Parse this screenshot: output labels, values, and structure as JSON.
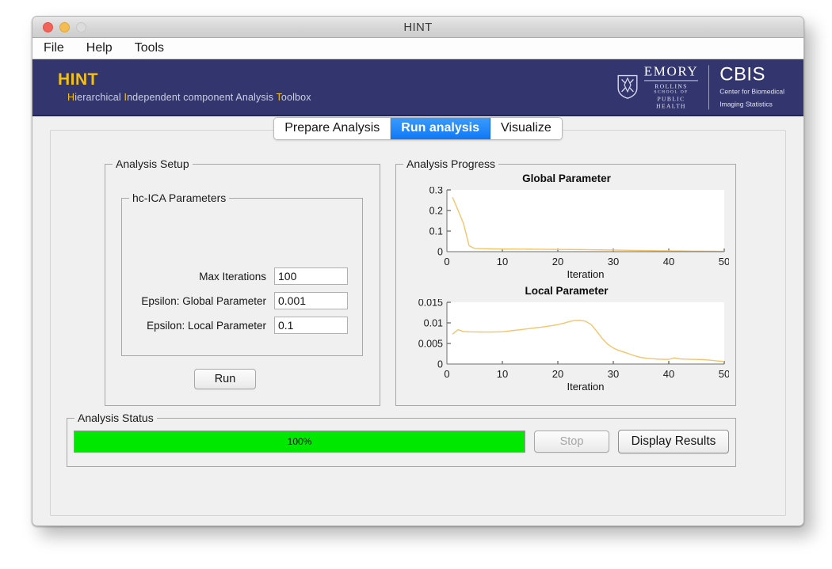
{
  "window": {
    "title": "HINT",
    "traffic_lights": [
      "close-red",
      "minimize-yellow",
      "zoom-gray-disabled"
    ]
  },
  "menubar": {
    "items": [
      {
        "label": "File"
      },
      {
        "label": "Help"
      },
      {
        "label": "Tools"
      }
    ]
  },
  "banner": {
    "brand_title": "HINT",
    "subtitle_parts": [
      {
        "text": "H",
        "highlight": true
      },
      {
        "text": "ierarchical ",
        "highlight": false
      },
      {
        "text": "I",
        "highlight": true
      },
      {
        "text": "ndependent component Analysis ",
        "highlight": false
      },
      {
        "text": "T",
        "highlight": true
      },
      {
        "text": "oolbox",
        "highlight": false
      }
    ],
    "subtitle_plain": "Hierarchical Independent component Analysis Toolbox",
    "accent_color": "#f2c01a",
    "background_color": "#32356e",
    "logos": {
      "emory": {
        "shield_icon": "emory-shield-icon",
        "word": "EMORY",
        "lines": [
          "ROLLINS",
          "SCHOOL OF",
          "PUBLIC",
          "HEALTH"
        ]
      },
      "cbis": {
        "word": "CBIS",
        "line1": "Center for Biomedical",
        "line2": "Imaging Statistics"
      }
    }
  },
  "tabs": [
    {
      "label": "Prepare Analysis",
      "active": false
    },
    {
      "label": "Run analysis",
      "active": true
    },
    {
      "label": "Visualize",
      "active": false
    }
  ],
  "setup": {
    "legend": "Analysis Setup",
    "params_legend": "hc-ICA Parameters",
    "fields": [
      {
        "label": "Max Iterations",
        "value": "100"
      },
      {
        "label": "Epsilon: Global Parameter",
        "value": "0.001"
      },
      {
        "label": "Epsilon: Local Parameter",
        "value": "0.1"
      }
    ],
    "run_button": "Run"
  },
  "progress": {
    "legend": "Analysis Progress"
  },
  "status": {
    "legend": "Analysis Status",
    "progress_percent": 100,
    "progress_label": "100%",
    "progress_color": "#00e800",
    "stop_button": "Stop",
    "stop_enabled": false,
    "display_button": "Display Results",
    "display_enabled": true
  },
  "chart_data": [
    {
      "type": "line",
      "title": "Global Parameter",
      "xlabel": "Iteration",
      "ylabel": "",
      "xlim": [
        0,
        50
      ],
      "ylim": [
        0,
        0.3
      ],
      "xticks": [
        0,
        10,
        20,
        30,
        40,
        50
      ],
      "yticks": [
        0,
        0.1,
        0.2,
        0.3
      ],
      "ytick_labels": [
        "0",
        "0.1",
        "0.2",
        "0.3"
      ],
      "grid": false,
      "legend": "none",
      "line_color": "#f4c46a",
      "x": [
        1,
        2,
        3,
        4,
        5,
        6,
        7,
        8,
        9,
        10,
        11,
        12,
        13,
        14,
        15,
        16,
        17,
        18,
        19,
        20,
        21,
        22,
        23,
        24,
        25,
        26,
        27,
        28,
        29,
        30,
        31,
        32,
        33,
        34,
        35,
        36,
        37,
        38,
        39,
        40,
        41,
        42,
        43,
        44,
        45,
        46,
        47,
        48,
        49,
        50
      ],
      "y": [
        0.265,
        0.202,
        0.136,
        0.029,
        0.0155,
        0.0145,
        0.014,
        0.0135,
        0.0132,
        0.013,
        0.0128,
        0.0126,
        0.0124,
        0.0122,
        0.012,
        0.0118,
        0.0116,
        0.0114,
        0.0112,
        0.011,
        0.0108,
        0.0106,
        0.0104,
        0.0101,
        0.0098,
        0.0094,
        0.009,
        0.0086,
        0.0082,
        0.0078,
        0.0074,
        0.007,
        0.0066,
        0.0062,
        0.0058,
        0.0054,
        0.005,
        0.0046,
        0.0043,
        0.004,
        0.0037,
        0.0034,
        0.0031,
        0.0028,
        0.0026,
        0.0024,
        0.0022,
        0.002,
        0.0018,
        0.0016
      ]
    },
    {
      "type": "line",
      "title": "Local Parameter",
      "xlabel": "Iteration",
      "ylabel": "",
      "xlim": [
        0,
        50
      ],
      "ylim": [
        0,
        0.015
      ],
      "xticks": [
        0,
        10,
        20,
        30,
        40,
        50
      ],
      "yticks": [
        0,
        0.005,
        0.01,
        0.015
      ],
      "ytick_labels": [
        "0",
        "0.005",
        "0.01",
        "0.015"
      ],
      "grid": false,
      "legend": "none",
      "line_color": "#f4c46a",
      "x": [
        1,
        2,
        3,
        4,
        5,
        6,
        7,
        8,
        9,
        10,
        11,
        12,
        13,
        14,
        15,
        16,
        17,
        18,
        19,
        20,
        21,
        22,
        23,
        24,
        25,
        26,
        27,
        28,
        29,
        30,
        31,
        32,
        33,
        34,
        35,
        36,
        37,
        38,
        39,
        40,
        41,
        42,
        43,
        44,
        45,
        46,
        47,
        48,
        49,
        50
      ],
      "y": [
        0.00725,
        0.00835,
        0.0079,
        0.00782,
        0.0078,
        0.00779,
        0.00778,
        0.00779,
        0.00781,
        0.00785,
        0.008,
        0.00815,
        0.0083,
        0.00848,
        0.00865,
        0.0088,
        0.00895,
        0.00915,
        0.00935,
        0.0096,
        0.0099,
        0.0103,
        0.01058,
        0.0106,
        0.0104,
        0.0096,
        0.008,
        0.0062,
        0.0048,
        0.0039,
        0.0033,
        0.00285,
        0.0024,
        0.00195,
        0.0016,
        0.0014,
        0.00128,
        0.0012,
        0.00115,
        0.00113,
        0.0015,
        0.00125,
        0.00118,
        0.00115,
        0.00112,
        0.00108,
        0.001,
        0.00085,
        0.00072,
        0.00062
      ]
    }
  ]
}
